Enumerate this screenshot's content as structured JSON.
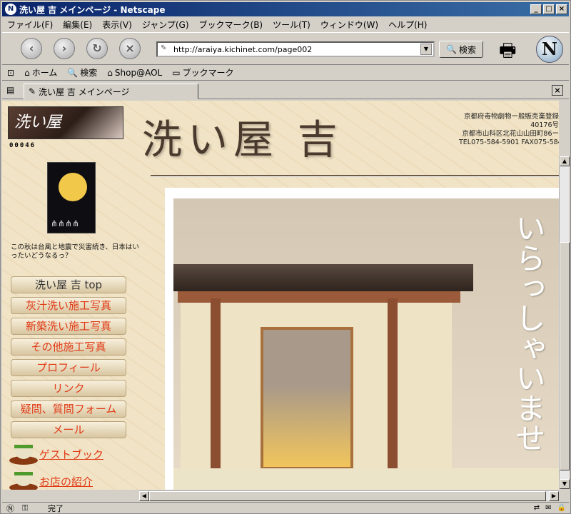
{
  "window": {
    "title": "洗い屋 吉 メインページ - Netscape"
  },
  "menubar": [
    "ファイル(F)",
    "編集(E)",
    "表示(V)",
    "ジャンプ(G)",
    "ブックマーク(B)",
    "ツール(T)",
    "ウィンドウ(W)",
    "ヘルプ(H)"
  ],
  "navbar": {
    "url": "http://araiya.kichinet.com/page002",
    "search_label": "検索"
  },
  "personal_toolbar": {
    "home": "ホーム",
    "search": "検索",
    "shop": "Shop@AOL",
    "bookmarks": "ブックマーク"
  },
  "tab": {
    "label": "洗い屋 吉 メインページ"
  },
  "page": {
    "logo_text": "洗い屋",
    "counter": "00046",
    "brush_title": "洗い屋 吉",
    "registration": [
      "京都府毒物劇物ー般販売業登録",
      "40176号",
      "京都市山科区北花山山田町86ー",
      "TEL075-584-5901 FAX075-584-59"
    ],
    "caption": "この秋は台風と地震で災害続き、日本はいったいどうなるっ？",
    "menu": [
      "洗い屋 吉 top",
      "灰汁洗い施工写真",
      "新築洗い施工写真",
      "その他施工写真",
      "プロフィール",
      "リンク",
      "疑問、質問フォーム",
      "メール"
    ],
    "guestbook": "ゲストブック",
    "shop_intro": "お店の紹介",
    "welcome": "いらっしゃいませ"
  },
  "status": {
    "text": "完了"
  },
  "colors": {
    "link": "#e03a16",
    "title_bar": "#0a246a"
  }
}
